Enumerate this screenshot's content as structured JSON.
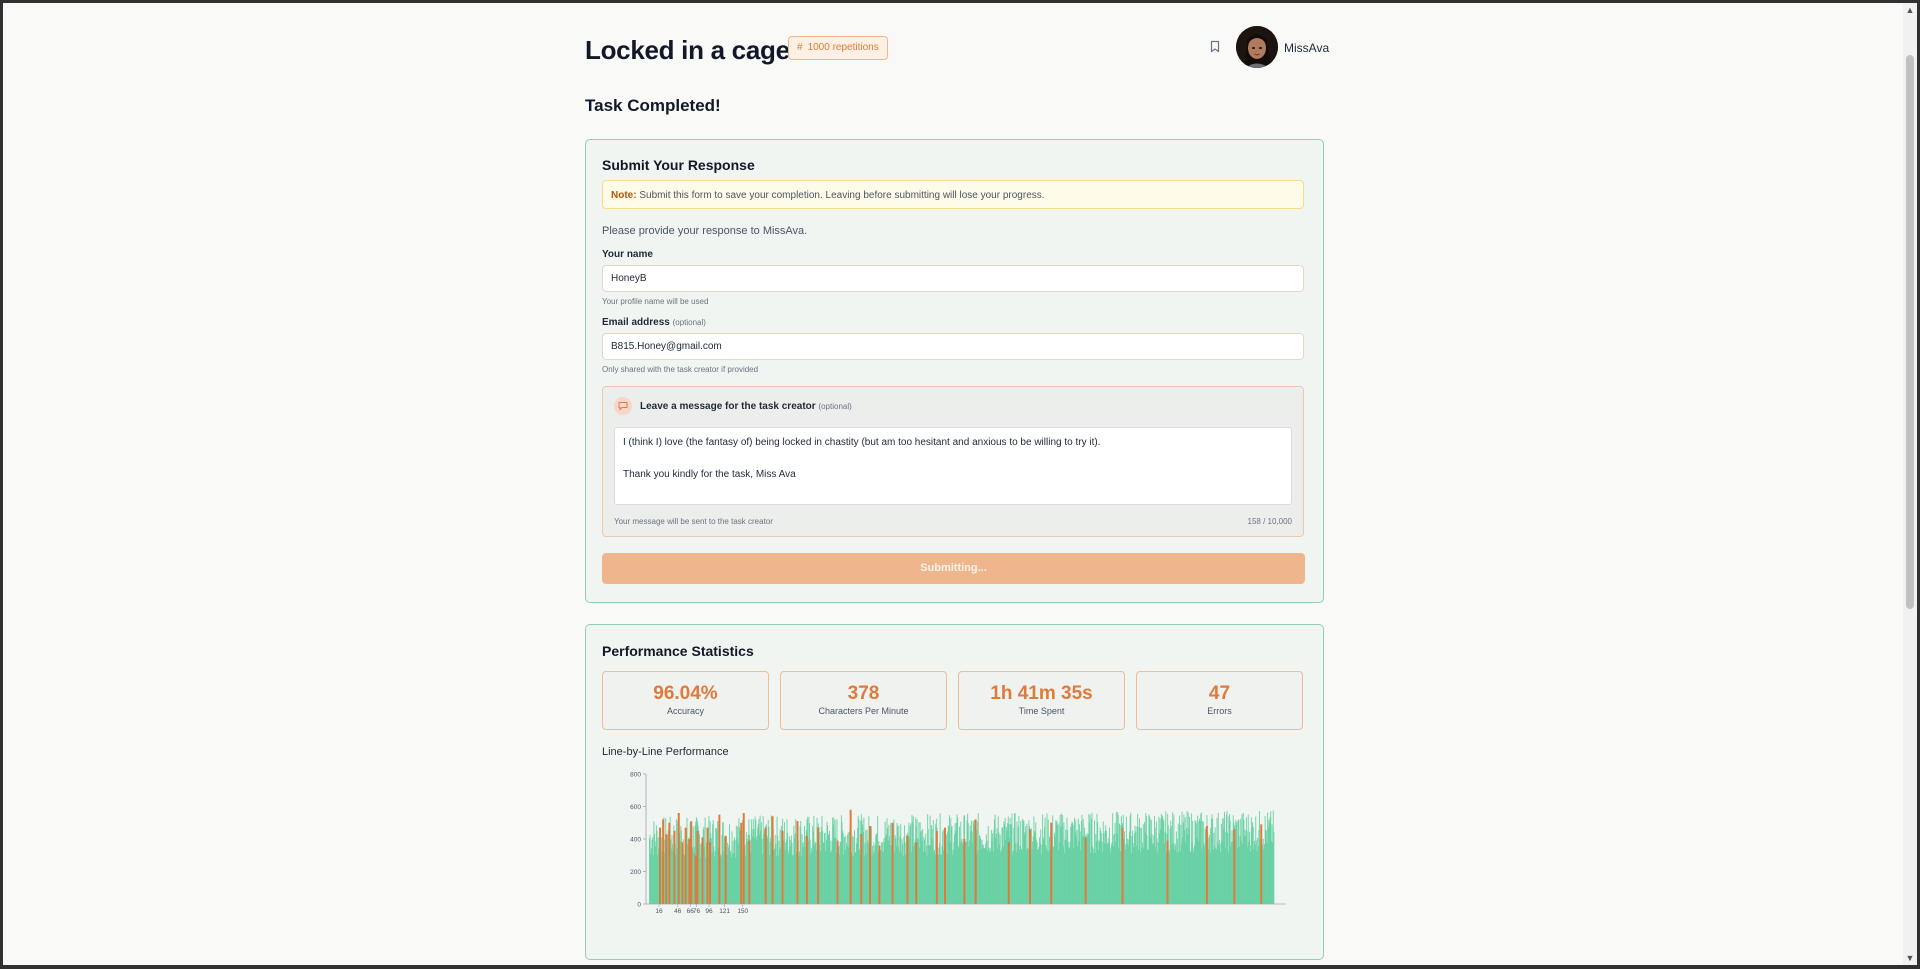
{
  "header": {
    "title": "Locked in a cage.",
    "badge_icon": "#",
    "badge": "1000 repetitions",
    "username": "MissAva"
  },
  "status": {
    "completed": "Task Completed!"
  },
  "form": {
    "title": "Submit Your Response",
    "note_label": "Note:",
    "note_text": "Submit this form to save your completion. Leaving before submitting will lose your progress.",
    "prompt": "Please provide your response to MissAva.",
    "name_label": "Your name",
    "name_value": "HoneyB",
    "name_hint": "Your profile name will be used",
    "email_label": "Email address",
    "email_optional": "(optional)",
    "email_value": "B815.Honey@gmail.com",
    "email_hint": "Only shared with the task creator if provided",
    "message_label": "Leave a message for the task creator",
    "message_optional": "(optional)",
    "message_line1": "I (think I) love (the fantasy of) being locked in chastity (but am too hesitant and anxious to be willing to try it).",
    "message_line2": "Thank you kindly for the task, Miss Ava",
    "message_hint": "Your message will be sent to the task creator",
    "message_count": "158 / 10,000",
    "submit_label": "Submitting..."
  },
  "stats": {
    "title": "Performance Statistics",
    "items": [
      {
        "value": "96.04%",
        "label": "Accuracy"
      },
      {
        "value": "378",
        "label": "Characters Per Minute"
      },
      {
        "value": "1h 41m 35s",
        "label": "Time Spent"
      },
      {
        "value": "47",
        "label": "Errors"
      }
    ],
    "chart_title": "Line-by-Line Performance"
  },
  "colors": {
    "accent": "#e07a3b",
    "success_bar": "#5fcf9f",
    "error_bar": "#e07a3b",
    "card_border": "#8fd1ae"
  },
  "chart_data": {
    "type": "bar",
    "title": "Line-by-Line Performance",
    "ylim": [
      0,
      800
    ],
    "y_ticks": [
      "800",
      "600",
      "400",
      "200",
      "0"
    ],
    "x_tick_labels": [
      "16",
      "46",
      "66",
      "76",
      "96",
      "121",
      "150"
    ],
    "series": [
      {
        "name": "",
        "color": "#5fcf9f",
        "values_range": [
          280,
          600
        ],
        "count": 1000
      },
      {
        "name": "",
        "color": "#e07a3b"
      }
    ],
    "error_lines": [
      16,
      21,
      26,
      31,
      39,
      46,
      52,
      57,
      63,
      66,
      73,
      76,
      84,
      92,
      96,
      111,
      121,
      146,
      150,
      159,
      185,
      196,
      212,
      236,
      251,
      269,
      300,
      321,
      338,
      352,
      367,
      388,
      412,
      426,
      459,
      472,
      503,
      521,
      574,
      608,
      642,
      697,
      756,
      828,
      891,
      935,
      978
    ],
    "error_values": [
      470,
      520,
      430,
      500,
      450,
      560,
      380,
      470,
      400,
      510,
      300,
      450,
      410,
      470,
      380,
      550,
      420,
      500,
      560,
      390,
      470,
      540,
      450,
      510,
      420,
      470,
      390,
      580,
      430,
      480,
      360,
      500,
      420,
      380,
      450,
      470,
      400,
      520,
      380,
      460,
      500,
      410,
      470,
      390,
      480,
      460,
      490
    ]
  }
}
